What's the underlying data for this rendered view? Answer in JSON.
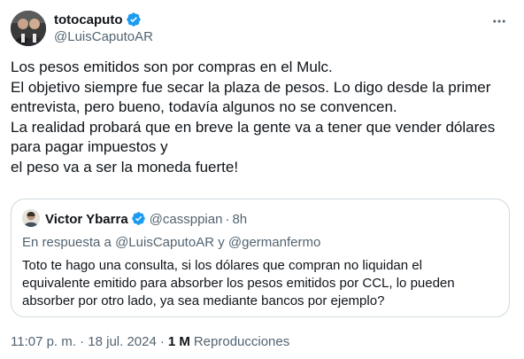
{
  "author": {
    "display_name": "totocaputo",
    "handle": "@LuisCaputoAR"
  },
  "tweet": {
    "lines": [
      "Los pesos emitidos son por compras en el Mulc.",
      "El objetivo siempre fue secar la plaza de pesos. Lo digo desde la primer",
      "entrevista, pero bueno, todavía algunos no se convencen.",
      "La realidad probará que en breve la gente va a tener que vender dólares",
      "para pagar impuestos y",
      "el peso va a ser la moneda fuerte!"
    ]
  },
  "quote": {
    "display_name": "Victor Ybarra",
    "handle": "@cassppian",
    "separator": "·",
    "time": "8h",
    "reply_prefix": "En respuesta a",
    "reply_mention_1": "@LuisCaputoAR",
    "reply_conj": "y",
    "reply_mention_2": "@germanfermo",
    "lines": [
      "Toto te hago una consulta, si los dólares que compran no liquidan el",
      "equivalente emitido para absorber los pesos emitidos por CCL, lo pueden",
      "absorber por otro lado, ya sea mediante bancos por ejemplo?"
    ]
  },
  "meta": {
    "timestamp": "11:07 p. m. · 18 jul. 2024",
    "separator": "·",
    "views_count": "1 M",
    "views_label": "Reproducciones"
  },
  "colors": {
    "verified_badge": "#1d9bf0",
    "secondary_text": "#536471",
    "border": "#cfd9de"
  },
  "icons": {
    "verified": "verified-badge-icon",
    "more": "more-options-icon"
  }
}
